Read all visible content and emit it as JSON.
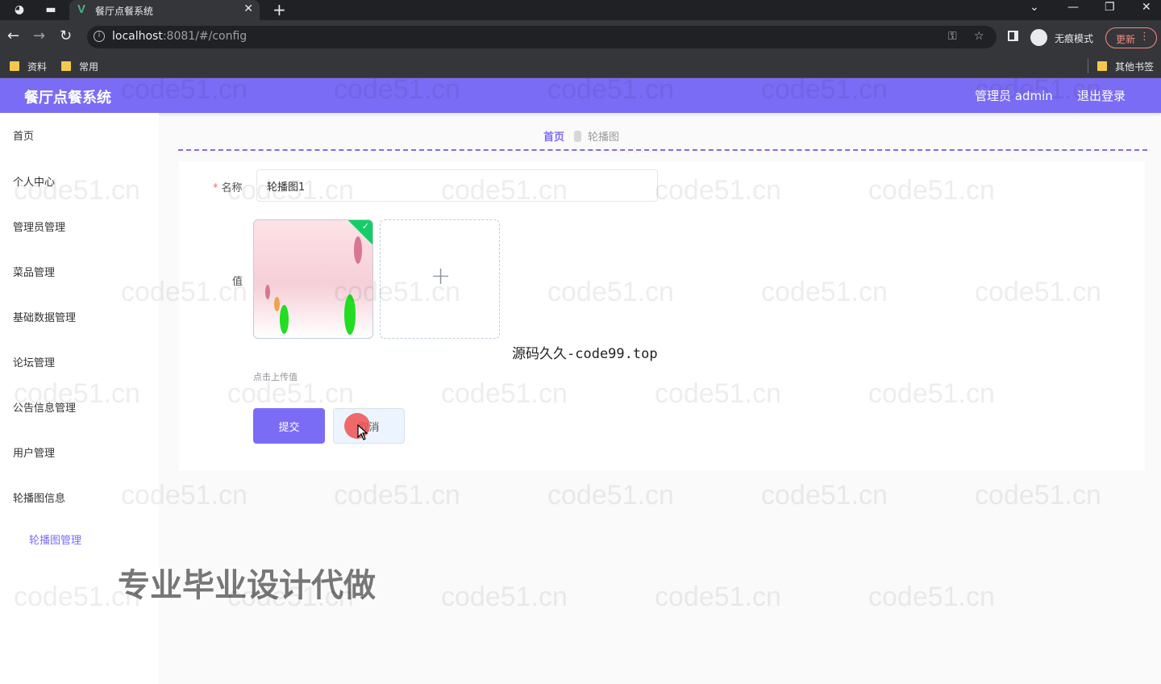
{
  "browser": {
    "tab_title": "餐厅点餐系统",
    "url_host": "localhost",
    "url_rest": ":8081/#/config",
    "incognito_label": "无痕模式",
    "update_label": "更新",
    "bookmarks": [
      "资料",
      "常用"
    ],
    "other_bookmarks": "其他书签"
  },
  "header": {
    "title": "餐厅点餐系统",
    "user": "管理员 admin",
    "logout": "退出登录"
  },
  "sidebar": {
    "items": [
      "首页",
      "个人中心",
      "管理员管理",
      "菜品管理",
      "基础数据管理",
      "论坛管理",
      "公告信息管理",
      "用户管理",
      "轮播图信息"
    ],
    "sub_item": "轮播图管理"
  },
  "breadcrumb": {
    "home": "首页",
    "current": "轮播图"
  },
  "form": {
    "name_label": "名称",
    "name_required": "*",
    "name_value": "轮播图1",
    "value_label": "值",
    "upload_tip": "点击上传值",
    "submit_label": "提交",
    "cancel_label": "取消"
  },
  "overlay": {
    "source_text": "源码久久-code99.top",
    "caption": "专业毕业设计代做",
    "watermark": "code51.cn"
  }
}
